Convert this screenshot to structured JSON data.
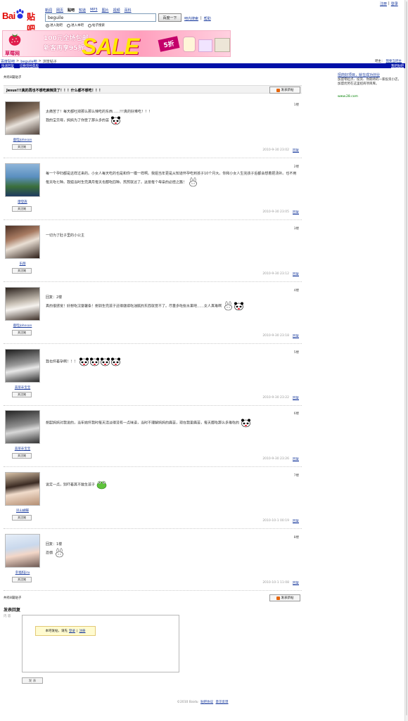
{
  "header": {
    "logo_bai": "Bai",
    "logo_tieba": "贴吧",
    "nav": [
      "新闻",
      "网页",
      "贴吧",
      "知道",
      "MP3",
      "图片",
      "视频",
      "百科"
    ],
    "nav_current": 2,
    "search_value": "beguile",
    "search_button": "百度一下",
    "search_links": [
      "吧内搜索",
      "帮助"
    ],
    "radios": [
      "进入贴吧",
      "进入本吧",
      "帖子搜索"
    ],
    "top_links": [
      "注册",
      "登录"
    ]
  },
  "banner": {
    "line1": "100元全场包邮",
    "line2": "新客再享95折",
    "sale": "SALE",
    "discount": "5折",
    "brand": "草莓网"
  },
  "breadcrumb": {
    "items": [
      "百度贴吧",
      "beguile吧",
      "浏览帖子"
    ],
    "right": [
      "吧主：",
      "我要当吧主"
    ]
  },
  "bluebar": {
    "left": [
      "快速回复",
      "切换到经典版"
    ],
    "right": "我吧贴吧"
  },
  "thread": {
    "count_text": "共有8篇贴子",
    "title": "Jesus!!!真的再也不想吃麻辣烫了！！！什么都不想吃！！！",
    "new_post": "发表新帖",
    "follow_label": "关注她",
    "reply_label": "回复"
  },
  "posts": [
    {
      "user": "鹿晗Johnson",
      "floor": "1楼",
      "content": "太痛苦了！每天都吐掉那么那么辣吃的东西……!!!真的好难吃！！！\n我的宝贝呀，妈妈为了你受了那么多的苦",
      "time": "2010-9-30 23:02"
    },
    {
      "user": "摩登族",
      "floor": "2楼",
      "content": "每一个孕妇都是这样过来的。小女人每天吃的也是和你一模一样啊。我姐当年更是从知道怀孕吃到孩子10个月大。你和小女人生完孩子后都会想着把汤补。也不用每天吃七种。我姐当时生完满月每天也都吃四种。熬熬就过了。这是每个母亲的必经之路！",
      "time": "2010-9-30 23:05"
    },
    {
      "user": "乐翔",
      "floor": "3楼",
      "content": "一切为了肚子里的小公主",
      "time": "2010-9-30 23:12"
    },
    {
      "user": "鹿晗Johnson",
      "floor": "4楼",
      "content": "回复：2楼\n真的很感觉！好想吃汉堡薯条！想到生完孩子还得继续吃油腻的东西就受不了。尽量多吃些水果吧……女人真难啊",
      "time": "2010-9-30 23:18"
    },
    {
      "user": "美丽辛宝宝",
      "floor": "5楼",
      "content": "我也怀着孕啊！！！",
      "time": "2010-9-30 23:22"
    },
    {
      "user": "美丽辛宝宝",
      "floor": "6楼",
      "content": "想起妈妈对我说的，当年她怀我时每天清淡得没有一点味道，当时不理解妈妈的痛苦，现在我更痛苦，每天都吃那么多难吃的",
      "time": "2010-9-30 23:26"
    },
    {
      "user": "凤山蝴蝶",
      "floor": "7楼",
      "content": "说定一点，别吓着其不敢生孩子",
      "time": "2010-10-1 00:19"
    },
    {
      "user": "幸福妈Jiru",
      "floor": "8楼",
      "content": "回复：1楼\n恐惧",
      "time": "2010-10-1 11:08"
    }
  ],
  "sidebar": {
    "title": "招商好项目，就在成功创业",
    "desc": "加盟零起点、投资、你期待的一家投资小店，加盟优势在这里招商项目库。",
    "url": "www.28.com"
  },
  "reply": {
    "heading": "发表回复",
    "label": "内 容",
    "tip": "本吧发帖，请先",
    "login": "登录",
    "sep": "|",
    "register": "注册",
    "submit": "发 表"
  },
  "footer": {
    "copyright": "©2010 Baidu",
    "links": [
      "贴吧协议",
      "意见反馈"
    ]
  },
  "colors": {
    "blue_bar": "#0010a8",
    "link": "#1b3c9e",
    "logo_red": "#e10602"
  }
}
